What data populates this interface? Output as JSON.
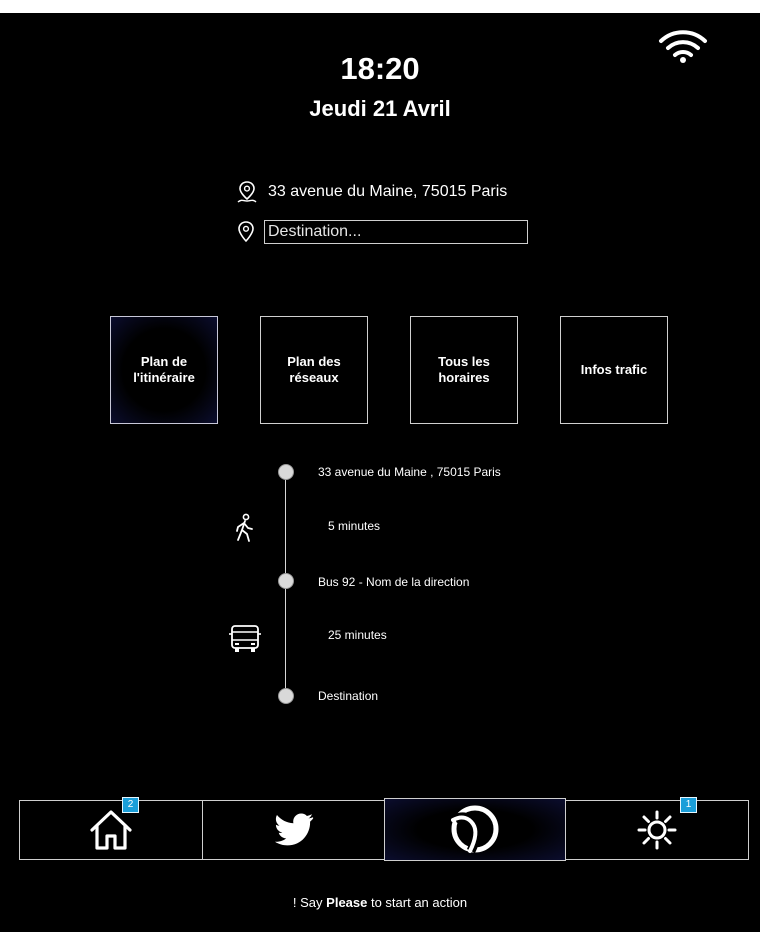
{
  "header": {
    "time": "18:20",
    "date": "Jeudi  21 Avril"
  },
  "status": {
    "wifi_icon": "wifi-icon"
  },
  "location": {
    "origin": "33 avenue du Maine, 75015 Paris",
    "destination_placeholder": "Destination...",
    "destination_value": ""
  },
  "menu": {
    "tiles": [
      {
        "line1": "Plan de",
        "line2": "l'itinéraire"
      },
      {
        "line1": "Plan des",
        "line2": "réseaux"
      },
      {
        "line1": "Tous les",
        "line2": "horaires"
      },
      {
        "line1": "Infos trafic",
        "line2": ""
      }
    ]
  },
  "itinerary": {
    "steps": [
      {
        "label": "33 avenue du Maine , 75015 Paris"
      },
      {
        "label": "5 minutes",
        "mode": "walk-icon"
      },
      {
        "label": "Bus 92 - Nom de la direction"
      },
      {
        "label": "25 minutes",
        "mode": "bus-icon"
      },
      {
        "label": "Destination"
      }
    ]
  },
  "nav": {
    "home_badge": "2",
    "settings_badge": "1",
    "icons": [
      "home-icon",
      "twitter-icon",
      "ratp-logo-icon",
      "sun-icon"
    ]
  },
  "hint": {
    "prefix": "! Say ",
    "keyword": "Please",
    "suffix": " to start an action"
  },
  "colors": {
    "background": "#000000",
    "badge": "#1a9ed9",
    "active_glow": "#0b0d2e"
  }
}
